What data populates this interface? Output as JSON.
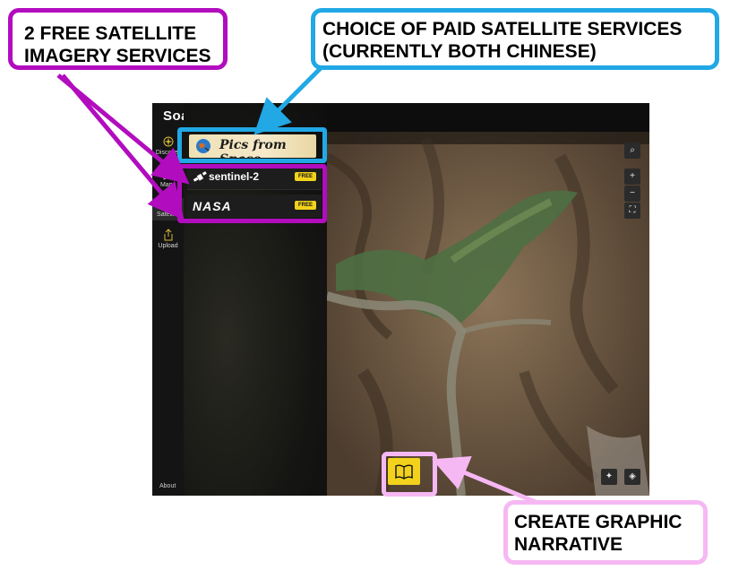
{
  "app": {
    "logo_text": "Soar",
    "nav": [
      {
        "label": "Discover",
        "icon": "compass-icon"
      },
      {
        "label": "Maps",
        "icon": "map-icon"
      },
      {
        "label": "Satellite",
        "icon": "satellite-icon"
      },
      {
        "label": "Upload",
        "icon": "upload-icon"
      }
    ],
    "about_label": "About",
    "services": {
      "paid": {
        "label": "Pics from Space",
        "icon": "globe-icon"
      },
      "free": [
        {
          "label": "sentinel-2",
          "badge": "FREE",
          "icon": "satellite-icon"
        },
        {
          "label": "NASA",
          "badge": "FREE",
          "icon": "nasa-logo"
        }
      ]
    },
    "map_controls": [
      "search-icon",
      "zoom-in-icon",
      "zoom-out-icon",
      "fit-icon",
      "satellite-toggle-icon",
      "layers-icon"
    ],
    "story_button_icon": "book-icon",
    "accent_color": "#f2d21c"
  },
  "annotations": {
    "free_services": [
      "2 FREE SATELLITE",
      "IMAGERY SERVICES"
    ],
    "paid_services": [
      "CHOICE OF PAID SATELLITE SERVICES",
      "(CURRENTLY BOTH CHINESE)"
    ],
    "graphic": [
      "CREATE GRAPHIC",
      "NARRATIVE"
    ],
    "colors": {
      "free": "#b20cbf",
      "paid": "#21a8e5",
      "graphic": "#f6b8f3"
    }
  }
}
